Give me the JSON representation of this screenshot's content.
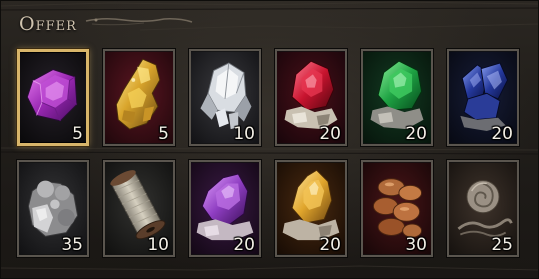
{
  "panel": {
    "title": "Offer"
  },
  "items": [
    {
      "name": "amethyst-gem",
      "qty": "5",
      "selected": true
    },
    {
      "name": "gold-ore",
      "qty": "5"
    },
    {
      "name": "quartz-crystal",
      "qty": "10"
    },
    {
      "name": "ruby-crystal",
      "qty": "20"
    },
    {
      "name": "emerald-crystal",
      "qty": "20"
    },
    {
      "name": "sapphire-cluster",
      "qty": "20"
    },
    {
      "name": "silver-ore",
      "qty": "35"
    },
    {
      "name": "thread-spool",
      "qty": "10"
    },
    {
      "name": "amethyst-crystal",
      "qty": "20"
    },
    {
      "name": "citrine-crystal",
      "qty": "20"
    },
    {
      "name": "copper-ore",
      "qty": "30"
    },
    {
      "name": "linen-bundle",
      "qty": "25"
    }
  ]
}
